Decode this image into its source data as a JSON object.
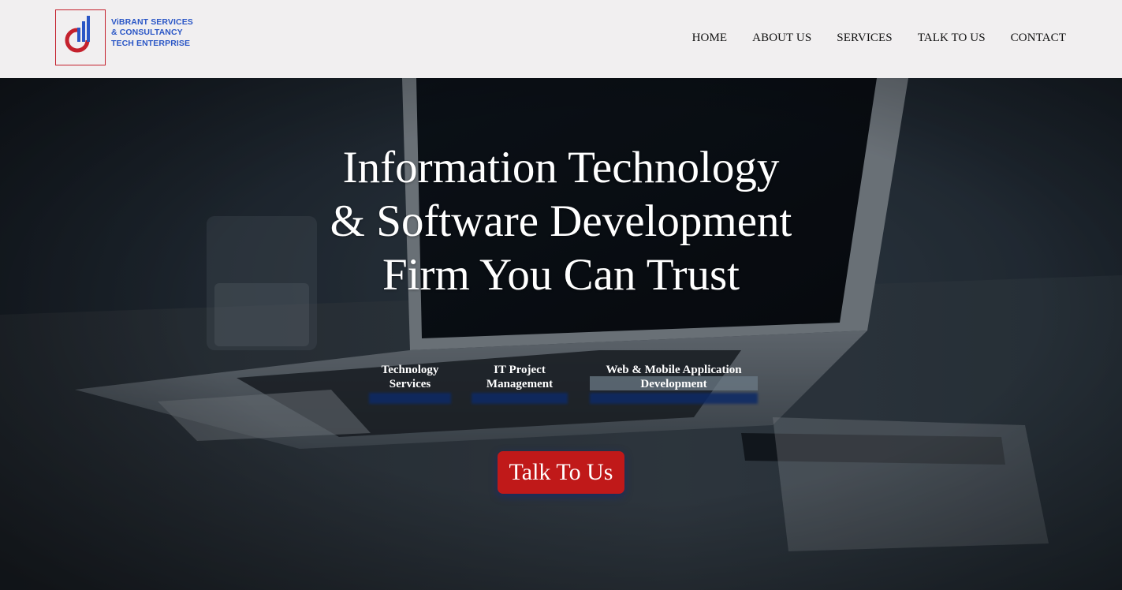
{
  "brand": {
    "line1": "ViBRANT SERVICES",
    "line2": "& CONSULTANCY",
    "line3": "TECH ENTERPRISE",
    "colors": {
      "red": "#c4212d",
      "blue": "#2a56c6"
    }
  },
  "nav": {
    "home": "HOME",
    "about": "ABOUT US",
    "services": "SERVICES",
    "talk": "TALK TO US",
    "contact": "CONTACT"
  },
  "hero": {
    "headline_line1": "Information Technology",
    "headline_line2": "& Software Development",
    "headline_line3": "Firm You Can Trust",
    "services": [
      {
        "line1": "Technology",
        "line2": "Services"
      },
      {
        "line1": "IT Project",
        "line2": "Management"
      },
      {
        "line1": "Web & Mobile Application",
        "line2": "Development"
      }
    ],
    "cta_label": "Talk To Us",
    "cta_color": "#c01919"
  }
}
